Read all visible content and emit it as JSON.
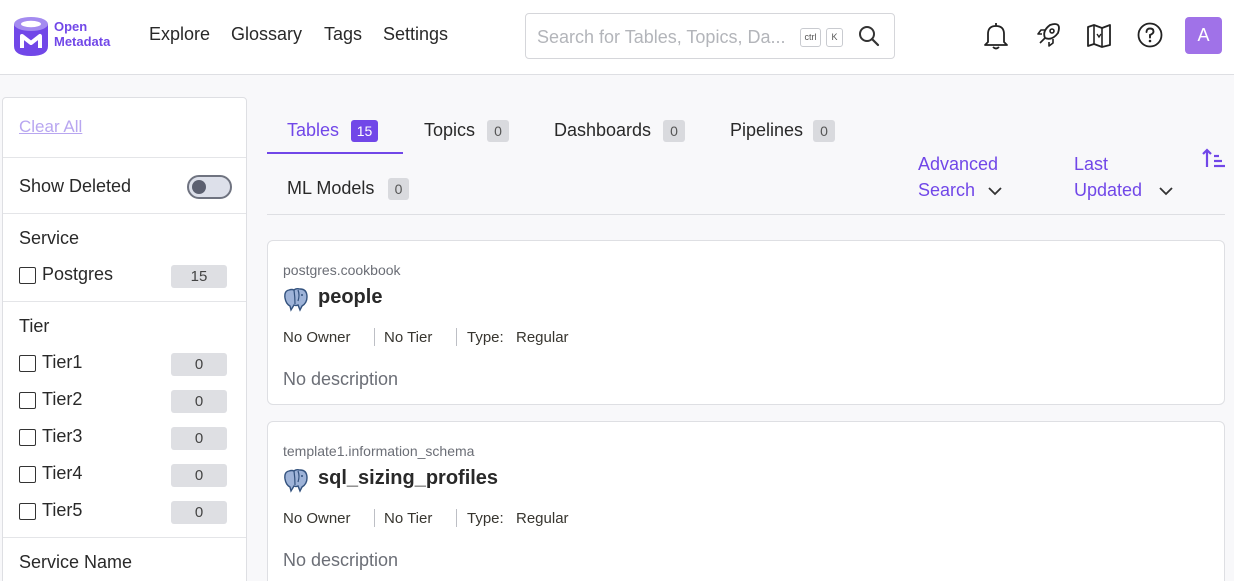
{
  "header": {
    "logo_line1": "Open",
    "logo_line2": "Metadata",
    "nav": [
      "Explore",
      "Glossary",
      "Tags",
      "Settings"
    ],
    "search_placeholder": "Search for Tables, Topics, Da...",
    "kbd_ctrl": "ctrl",
    "kbd_k": "K",
    "avatar_initial": "A",
    "brand_color": "#7147e8"
  },
  "sidebar": {
    "clear_all": "Clear All",
    "show_deleted": "Show Deleted",
    "service_title": "Service",
    "services": [
      {
        "label": "Postgres",
        "count": "15"
      }
    ],
    "tier_title": "Tier",
    "tiers": [
      {
        "label": "Tier1",
        "count": "0"
      },
      {
        "label": "Tier2",
        "count": "0"
      },
      {
        "label": "Tier3",
        "count": "0"
      },
      {
        "label": "Tier4",
        "count": "0"
      },
      {
        "label": "Tier5",
        "count": "0"
      }
    ],
    "service_name_title": "Service Name"
  },
  "tabs": [
    {
      "label": "Tables",
      "count": "15"
    },
    {
      "label": "Topics",
      "count": "0"
    },
    {
      "label": "Dashboards",
      "count": "0"
    },
    {
      "label": "Pipelines",
      "count": "0"
    },
    {
      "label": "ML Models",
      "count": "0"
    }
  ],
  "advanced_search": {
    "line1": "Advanced",
    "line2": "Search"
  },
  "sort": {
    "line1": "Last",
    "line2": "Updated"
  },
  "results": [
    {
      "path": "postgres.cookbook",
      "name": "people",
      "owner": "No Owner",
      "tier": "No Tier",
      "type_label": "Type:",
      "type_value": "Regular",
      "description": "No description"
    },
    {
      "path": "template1.information_schema",
      "name": "sql_sizing_profiles",
      "owner": "No Owner",
      "tier": "No Tier",
      "type_label": "Type:",
      "type_value": "Regular",
      "description": "No description"
    }
  ]
}
